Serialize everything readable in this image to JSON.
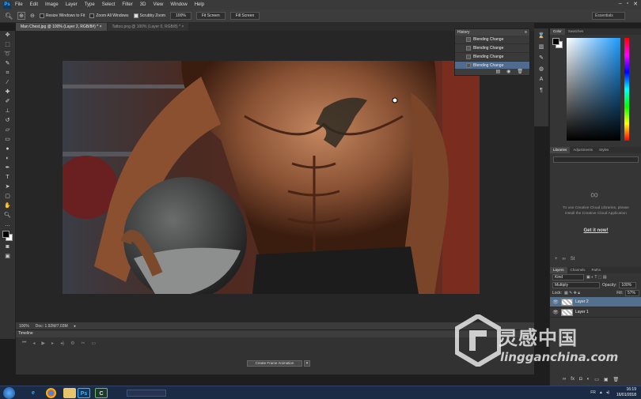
{
  "menubar": {
    "app_icon": "Ps",
    "items": [
      "File",
      "Edit",
      "Image",
      "Layer",
      "Type",
      "Select",
      "Filter",
      "3D",
      "View",
      "Window",
      "Help"
    ],
    "window_controls": [
      "minimize-icon",
      "restore-icon",
      "close-icon"
    ]
  },
  "options": {
    "resize_windows": "Resize Windows to Fit",
    "zoom_all": "Zoom All Windows",
    "scrubby_zoom": "Scrubby Zoom",
    "btn_100": "100%",
    "btn_fit": "Fit Screen",
    "btn_fill": "Fill Screen",
    "workspace": "Essentials"
  },
  "tabs": [
    {
      "label": "Man Chest.jpg @ 100% (Layer 2, RGB/8#) *",
      "active": true
    },
    {
      "label": "Tattoo.png @ 100% (Layer 0, RGB/8) *",
      "active": false
    }
  ],
  "status": {
    "zoom": "100%",
    "doc": "Doc: 1.92M/7.03M"
  },
  "timeline": {
    "title": "Timeline",
    "create_button": "Create Frame Animation"
  },
  "history": {
    "title": "History",
    "items": [
      {
        "label": "Blending Change",
        "selected": false
      },
      {
        "label": "Blending Change",
        "selected": false
      },
      {
        "label": "Blending Change",
        "selected": false
      },
      {
        "label": "Blending Change",
        "selected": true
      }
    ]
  },
  "color_panel": {
    "tabs": [
      "Color",
      "Swatches"
    ]
  },
  "libraries": {
    "tabs": [
      "Libraries",
      "Adjustments",
      "Styles"
    ],
    "message": "To use Creative Cloud Libraries, please install the Creative Cloud Application",
    "link": "Get it now!"
  },
  "layers": {
    "tabs": [
      "Layers",
      "Channels",
      "Paths"
    ],
    "kind": "Kind",
    "blend_mode": "Multiply",
    "opacity_label": "Opacity:",
    "opacity": "100%",
    "lock_label": "Lock:",
    "fill_label": "Fill:",
    "fill": "57%",
    "items": [
      {
        "name": "Layer 2",
        "selected": true
      },
      {
        "name": "Layer 1",
        "selected": false
      }
    ]
  },
  "taskbar": {
    "apps": [
      "ie-icon",
      "chrome-icon",
      "explorer-icon",
      "Ps",
      "C"
    ],
    "lang": "FR",
    "time": "16:19",
    "date": "16/01/2018"
  },
  "watermark": {
    "cn": "灵感中国",
    "en": "lingganchina.com"
  }
}
